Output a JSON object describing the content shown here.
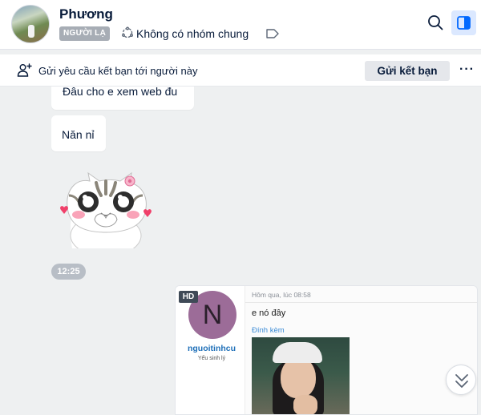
{
  "header": {
    "name": "Phương",
    "badge": "NGƯỜI LẠ",
    "common_groups": "Không có nhóm chung",
    "icons": {
      "common_groups": "group-circle-icon",
      "tag": "tag-icon",
      "search": "search-icon",
      "panel": "sidebar-panel-icon"
    },
    "accent_color": "#0068ff"
  },
  "friend_request": {
    "text": "Gửi yêu cầu kết bạn tới người này",
    "button_label": "Gửi kết bạn",
    "more_label": "···"
  },
  "messages": [
    {
      "text": "Đâu cho e xem web đu"
    },
    {
      "text": "Năn nỉ"
    }
  ],
  "sticker": {
    "name": "cat-pleading-sticker"
  },
  "time_chip": "12:25",
  "forwarded_card": {
    "hd_label": "HD",
    "avatar_letter": "N",
    "username": "nguoitinhcu",
    "status": "Yếu sinh lý",
    "timestamp": "Hôm qua, lúc 08:58",
    "message": "e nó đây",
    "attachment_label": "Đính kèm"
  }
}
